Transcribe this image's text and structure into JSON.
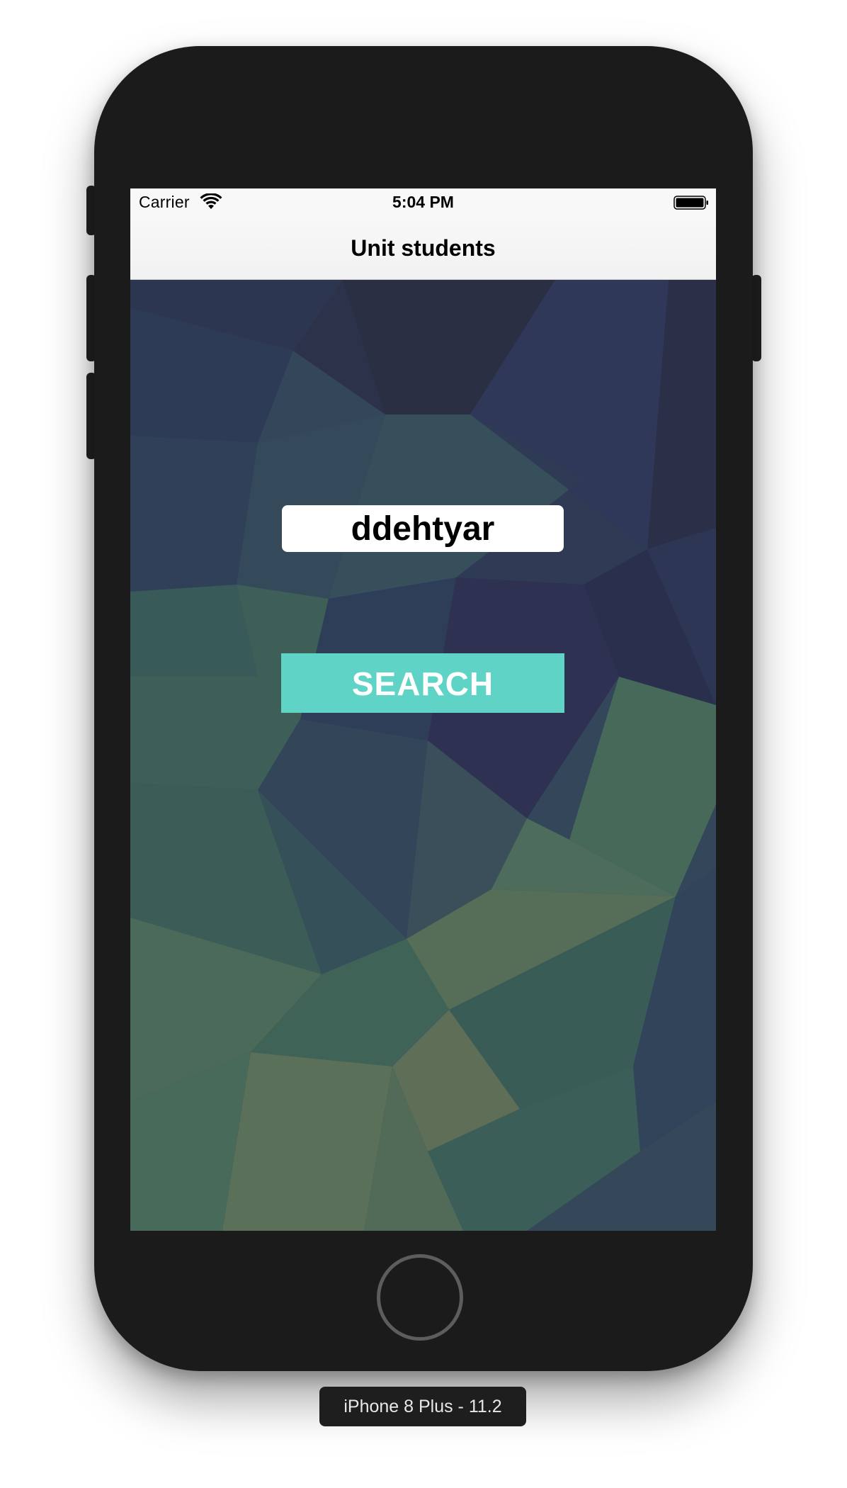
{
  "status_bar": {
    "carrier": "Carrier",
    "time": "5:04 PM",
    "wifi_icon": "wifi-icon",
    "battery_icon": "battery-icon"
  },
  "nav_bar": {
    "title": "Unit students"
  },
  "search_form": {
    "username_value": "ddehtyar",
    "search_label": "SEARCH"
  },
  "simulator": {
    "device_label": "iPhone 8 Plus - 11.2",
    "home_button_icon": "home-button-icon"
  },
  "colors": {
    "accent": "#5fd3c5",
    "background_dark": "#2f3e51",
    "background_green": "#3f5e55",
    "device_body": "#1b1b1b"
  }
}
